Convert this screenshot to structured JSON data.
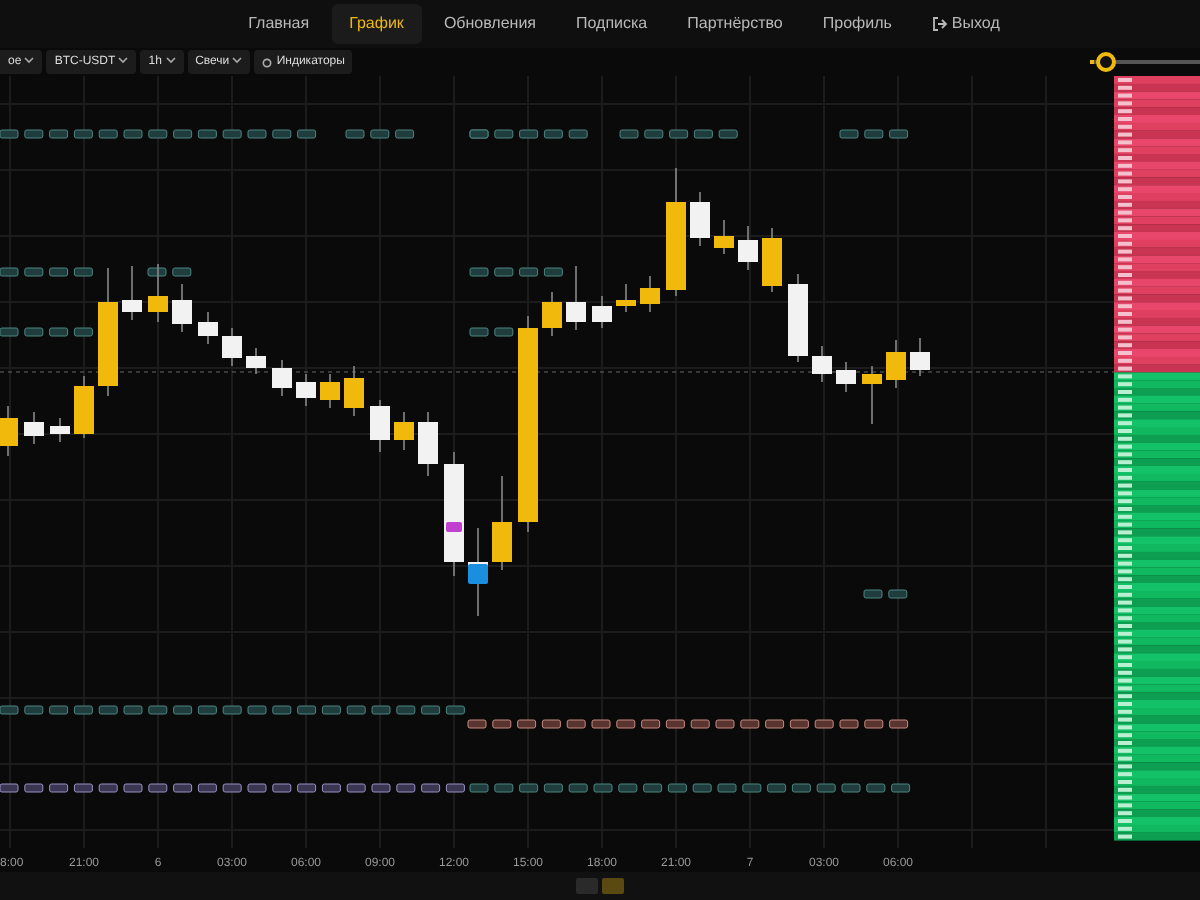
{
  "nav": {
    "items": [
      {
        "label": "Главная",
        "selected": false,
        "kind": "link"
      },
      {
        "label": "График",
        "selected": true,
        "kind": "link"
      },
      {
        "label": "Обновления",
        "selected": false,
        "kind": "link"
      },
      {
        "label": "Подписка",
        "selected": false,
        "kind": "link"
      },
      {
        "label": "Партнёрство",
        "selected": false,
        "kind": "link"
      },
      {
        "label": "Профиль",
        "selected": false,
        "kind": "link"
      },
      {
        "label": "Выход",
        "selected": false,
        "kind": "logout"
      }
    ]
  },
  "toolbar": {
    "mode": "ое",
    "pair": "BTC-USDT",
    "interval": "1h",
    "chart_type": "Свечи",
    "indicators": "Индикаторы",
    "zoom_slider": {
      "level": 0.15
    }
  },
  "chart": {
    "x_labels": [
      "8:00",
      "21:00",
      "6",
      "03:00",
      "06:00",
      "09:00",
      "12:00",
      "15:00",
      "18:00",
      "21:00",
      "7",
      "03:00",
      "06:00"
    ]
  },
  "bottom_toggles": [
    {
      "selected": false
    },
    {
      "selected": true
    }
  ]
}
